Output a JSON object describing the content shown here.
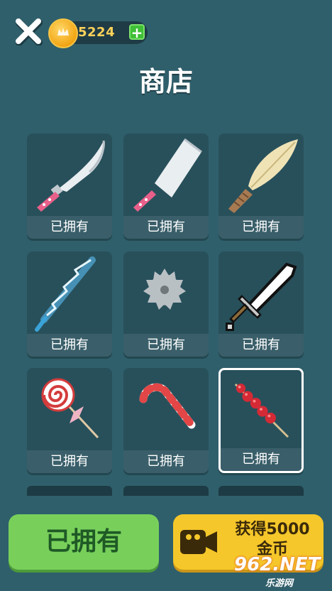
{
  "header": {
    "close_icon": "close-x-icon",
    "coins": "5224",
    "coin_icon": "gold-coin-icon",
    "add_icon": "plus-icon",
    "add_label": "+"
  },
  "title": "商店",
  "items": [
    {
      "icon": "kitchen-knife-icon",
      "label": "已拥有"
    },
    {
      "icon": "cleaver-icon",
      "label": "已拥有"
    },
    {
      "icon": "leaf-dagger-icon",
      "label": "已拥有"
    },
    {
      "icon": "lightning-sword-icon",
      "label": "已拥有"
    },
    {
      "icon": "saw-blade-icon",
      "label": "已拥有"
    },
    {
      "icon": "pixel-sword-icon",
      "label": "已拥有"
    },
    {
      "icon": "lollipop-icon",
      "label": "已拥有"
    },
    {
      "icon": "candy-cane-icon",
      "label": "已拥有"
    },
    {
      "icon": "candied-haws-icon",
      "label": "已拥有",
      "selected": true
    }
  ],
  "footer": {
    "owned_label": "已拥有",
    "reward_label_line1": "获得5000",
    "reward_label_line2": "金币",
    "video_icon": "video-camera-icon"
  },
  "watermark": {
    "main": "962.NET",
    "sub": "乐游网"
  },
  "colors": {
    "background": "#2f5f6b",
    "card": "#28505b",
    "green_button": "#78d05b",
    "yellow_button": "#f5c72a"
  }
}
